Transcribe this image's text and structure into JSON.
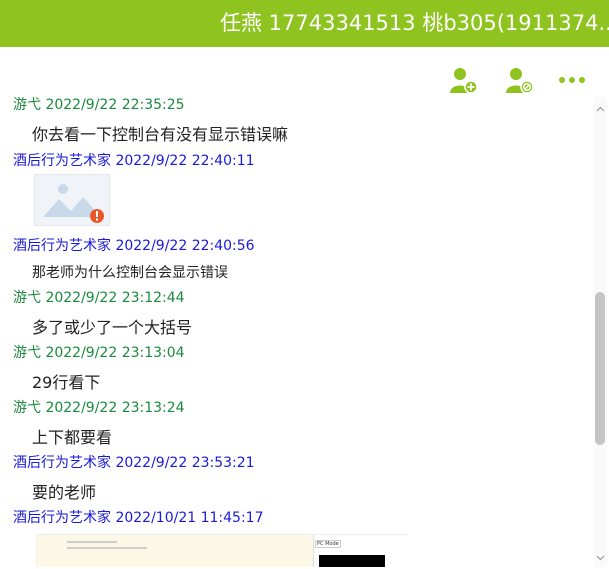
{
  "window": {
    "title": "任燕 17743341513 桃b305(1911374..."
  },
  "toolbar": {
    "add_user_icon": "add-user-icon",
    "remove_user_icon": "remove-user-icon",
    "more_icon": "more-icon"
  },
  "messages": [
    {
      "sender": "游弋",
      "time": "2022/9/22 22:35:25",
      "side": "them",
      "text": "你去看一下控制台有没有显示错误嘛"
    },
    {
      "sender": "酒后行为艺术家",
      "time": "2022/9/22 22:40:11",
      "side": "me",
      "image": "broken-image"
    },
    {
      "sender": "酒后行为艺术家",
      "time": "2022/9/22 22:40:56",
      "side": "me",
      "text": "那老师为什么控制台会显示错误"
    },
    {
      "sender": "游弋",
      "time": "2022/9/22 23:12:44",
      "side": "them",
      "text": "多了或少了一个大括号"
    },
    {
      "sender": "游弋",
      "time": "2022/9/22 23:13:04",
      "side": "them",
      "text": "29行看下"
    },
    {
      "sender": "游弋",
      "time": "2022/9/22 23:13:24",
      "side": "them",
      "text": "上下都要看"
    },
    {
      "sender": "酒后行为艺术家",
      "time": "2022/9/22 23:53:21",
      "side": "me",
      "text": "要的老师"
    },
    {
      "sender": "酒后行为艺术家",
      "time": "2022/10/21 11:45:17",
      "side": "me",
      "image": "screenshot-image",
      "image_caption": "PC Mode"
    }
  ],
  "colors": {
    "accent": "#8fc31f",
    "them_name": "#1a8a3d",
    "me_name": "#1a1adb"
  }
}
